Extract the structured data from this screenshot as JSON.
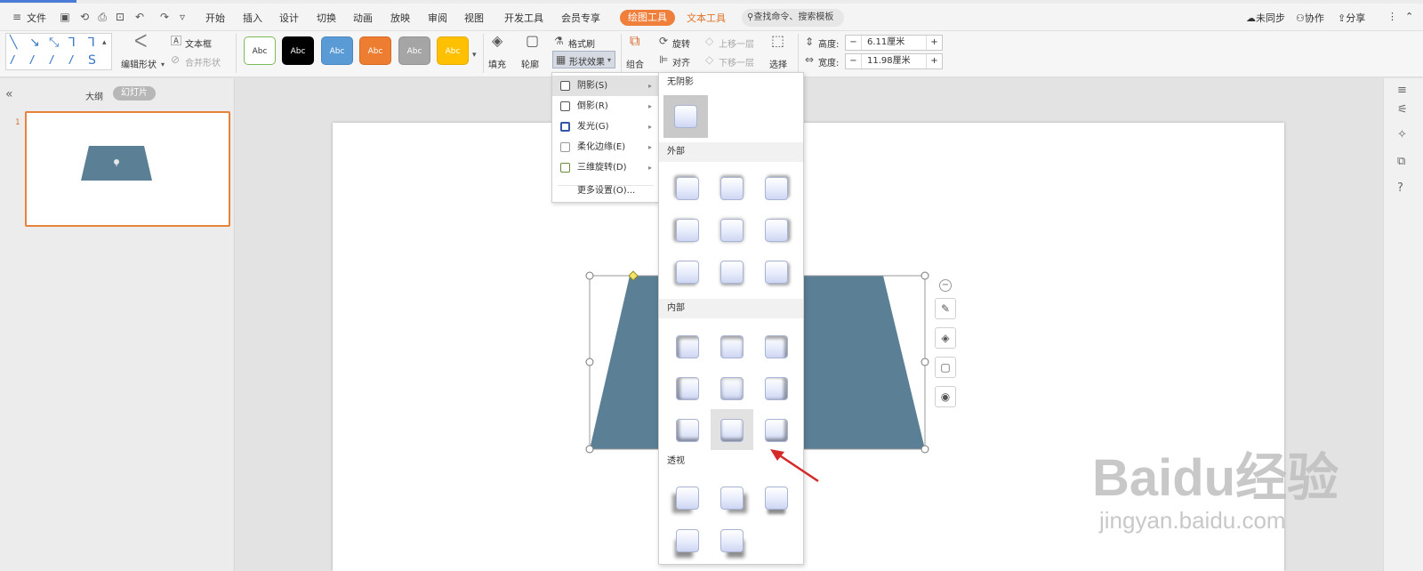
{
  "menubar": {
    "file_label": "文件",
    "tabs": [
      "开始",
      "插入",
      "设计",
      "切换",
      "动画",
      "放映",
      "审阅",
      "视图",
      "开发工具",
      "会员专享"
    ],
    "active_tab": "绘图工具",
    "text_tools_tab": "文本工具",
    "search_placeholder": "查找命令、搜索模板",
    "sync_label": "未同步",
    "collab_label": "协作",
    "share_label": "分享"
  },
  "ribbon": {
    "edit_shape_label": "编辑形状",
    "textbox_label": "文本框",
    "merge_shape_label": "合并形状",
    "style_swatches": [
      {
        "label": "Abc",
        "bg": "#ffffff",
        "fg": "#333333",
        "border": "#7cba59"
      },
      {
        "label": "Abc",
        "bg": "#000000",
        "fg": "#ffffff",
        "border": "#000000"
      },
      {
        "label": "Abc",
        "bg": "#5b9bd5",
        "fg": "#ffffff",
        "border": "#4a88c3"
      },
      {
        "label": "Abc",
        "bg": "#ed7d31",
        "fg": "#ffffff",
        "border": "#d66a22"
      },
      {
        "label": "Abc",
        "bg": "#a5a5a5",
        "fg": "#ffffff",
        "border": "#939393"
      },
      {
        "label": "Abc",
        "bg": "#ffc000",
        "fg": "#ffffff",
        "border": "#e6ad00"
      }
    ],
    "fill_label": "填充",
    "outline_label": "轮廓",
    "format_painter_label": "格式刷",
    "shape_effect_label": "形状效果",
    "group_label": "组合",
    "rotate_label": "旋转",
    "align_label": "对齐",
    "bring_forward_label": "上移一层",
    "send_backward_label": "下移一层",
    "select_label": "选择",
    "height_label": "高度:",
    "height_value": "6.11厘米",
    "width_label": "宽度:",
    "width_value": "11.98厘米"
  },
  "left_panel": {
    "outline_tab": "大纲",
    "slides_tab": "幻灯片",
    "slide_number": "1"
  },
  "effect_menu": {
    "items": [
      {
        "label": "阴影(S)",
        "has_submenu": true,
        "selected": true
      },
      {
        "label": "倒影(R)",
        "has_submenu": true,
        "selected": false
      },
      {
        "label": "发光(G)",
        "has_submenu": true,
        "selected": false
      },
      {
        "label": "柔化边缘(E)",
        "has_submenu": true,
        "selected": false
      },
      {
        "label": "三维旋转(D)",
        "has_submenu": true,
        "selected": false
      }
    ],
    "more_settings": "更多设置(O)..."
  },
  "shadow_submenu": {
    "no_shadow": "无阴影",
    "outer": "外部",
    "inner": "内部",
    "perspective": "透视"
  },
  "colors": {
    "accent_orange": "#f07f3c",
    "shape_fill": "#5b7f94",
    "annotation_red": "#d42a2a"
  },
  "watermark": {
    "brand": "Baidu经验",
    "url": "jingyan.baidu.com"
  }
}
